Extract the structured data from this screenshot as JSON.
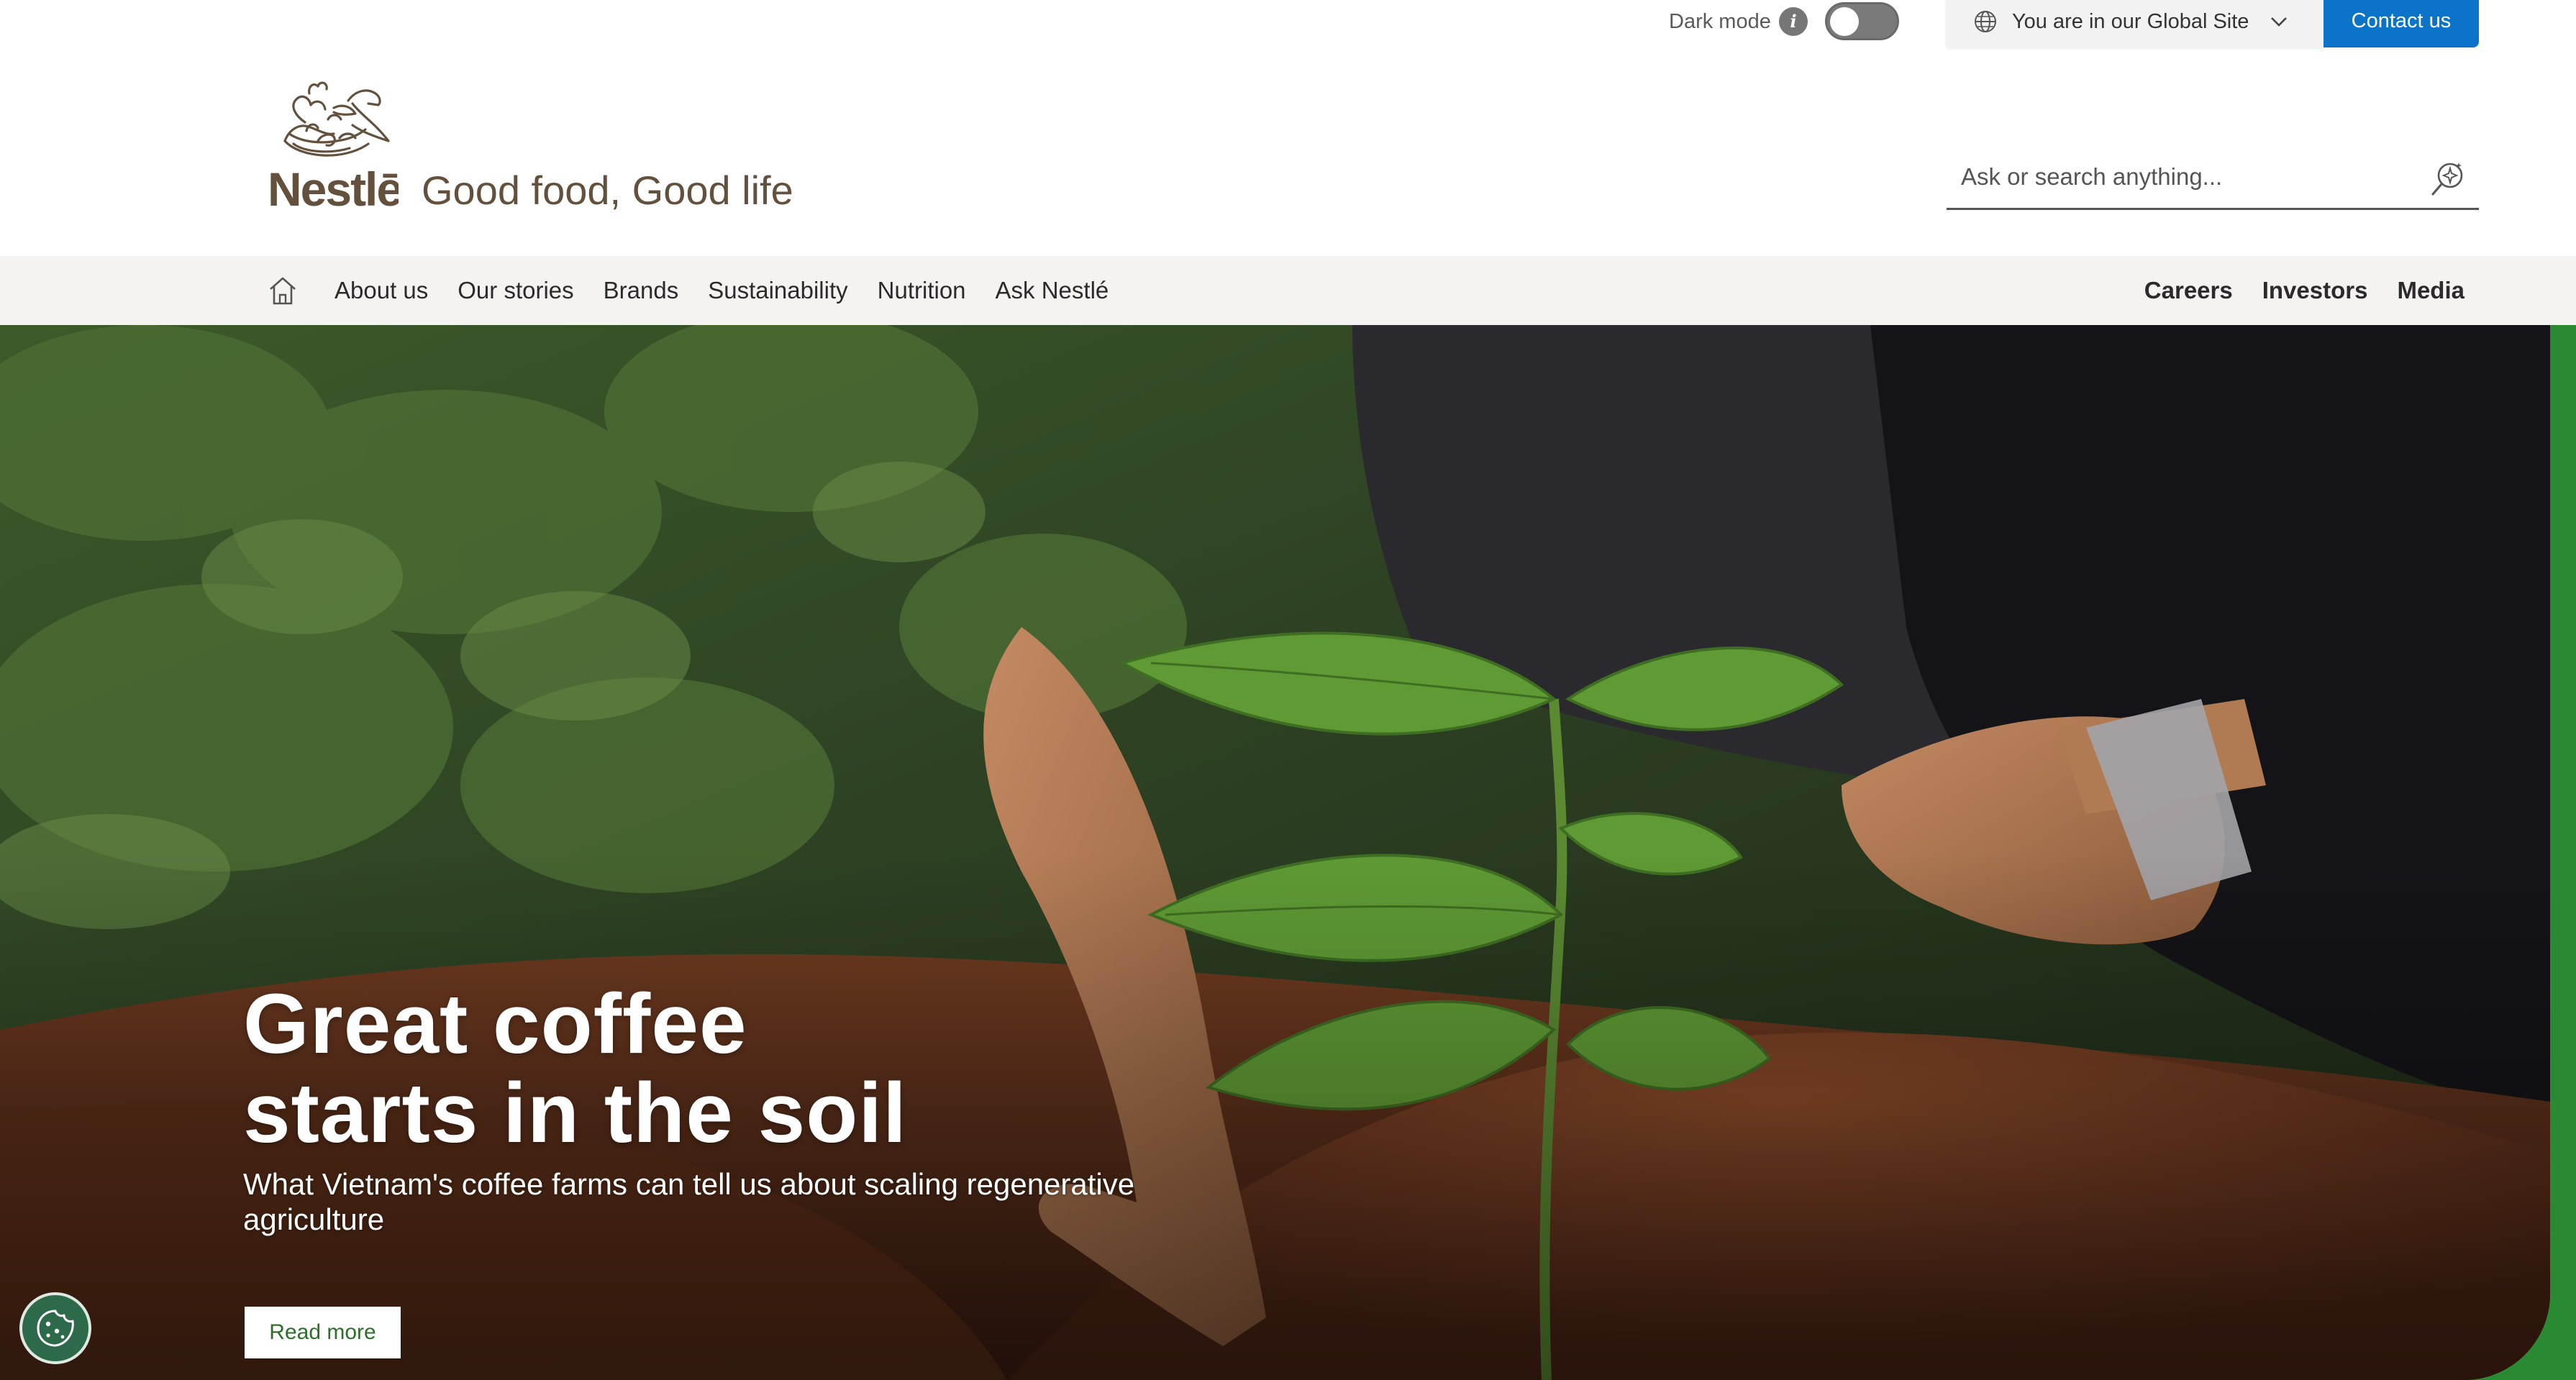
{
  "utility_bar": {
    "dark_mode_label": "Dark mode",
    "dark_mode_enabled": false,
    "info_icon": "info-icon",
    "site_selector": "You are in our Global Site",
    "contact_label": "Contact us"
  },
  "header": {
    "logo_text": "Nestlē",
    "tagline": "Good food, Good life",
    "search_placeholder": "Ask or search anything..."
  },
  "nav": {
    "home_icon": "home-icon",
    "left_items": [
      "About us",
      "Our stories",
      "Brands",
      "Sustainability",
      "Nutrition",
      "Ask Nestlé"
    ],
    "right_items": [
      "Careers",
      "Investors",
      "Media"
    ]
  },
  "hero": {
    "title_line1": "Great coffee",
    "title_line2": "starts in the soil",
    "subtitle": "What Vietnam's coffee farms can tell us about scaling regenerative agriculture",
    "cta": "Read more"
  },
  "colors": {
    "brand_brown": "#63513d",
    "contact_blue": "#0b74c8",
    "accent_green": "#2a8a32",
    "nav_bg": "#f4f3f1"
  }
}
